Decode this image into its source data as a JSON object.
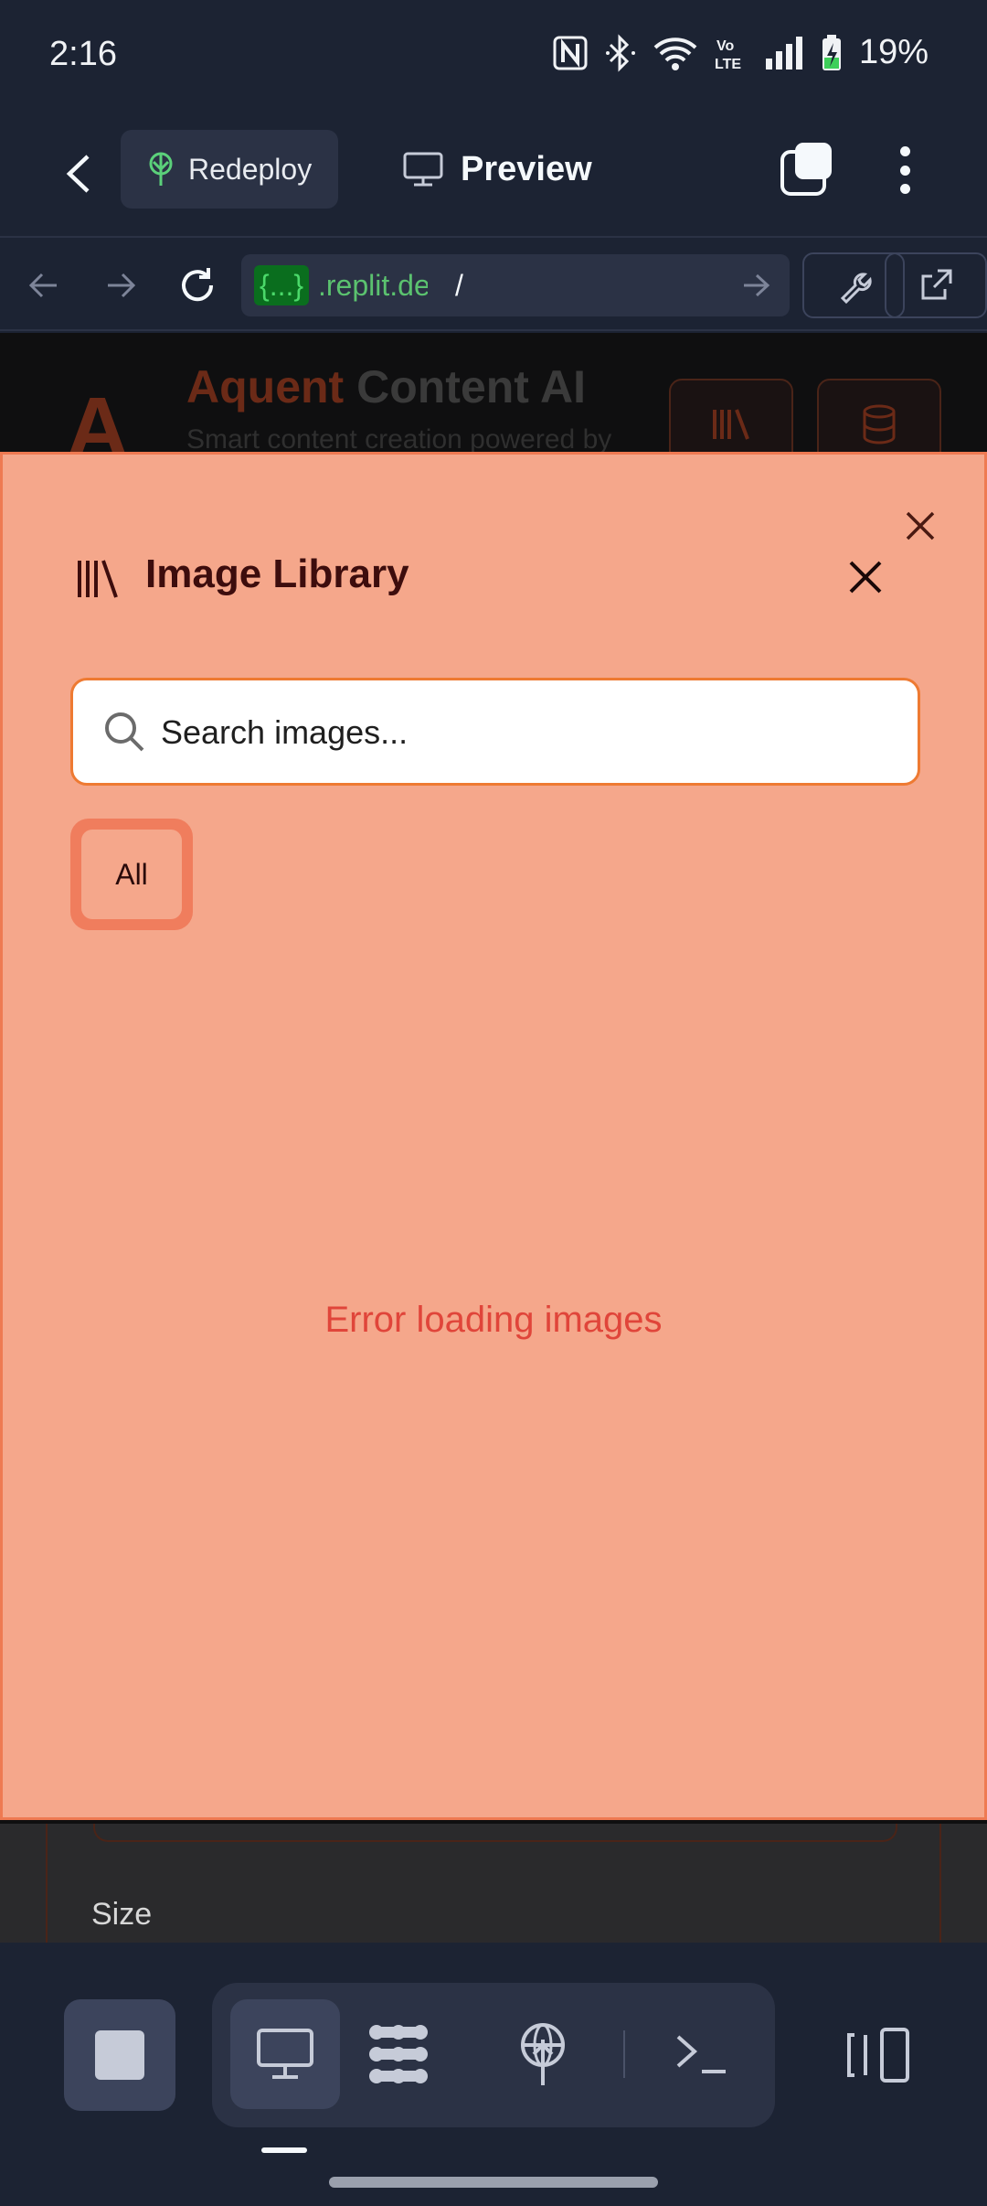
{
  "status_bar": {
    "time": "2:16",
    "battery": "19%",
    "icons": [
      "nfc-icon",
      "bluetooth-icon",
      "wifi-icon",
      "volte-icon",
      "signal-icon",
      "battery-charging-icon"
    ],
    "volte_text": "Vo LTE"
  },
  "app_bar": {
    "redeploy_label": "Redeploy",
    "preview_label": "Preview"
  },
  "url_bar": {
    "badge": "{...}",
    "domain": ".replit.de",
    "path": "/"
  },
  "web_background": {
    "logo_letter": "A",
    "title_brand": "Aquent",
    "title_rest": " Content AI",
    "subtitle": "Smart content creation powered by",
    "size_label": "Size"
  },
  "modal": {
    "title": "Image Library",
    "search_placeholder": "Search images...",
    "filters": [
      "All"
    ],
    "error_message": "Error loading images"
  },
  "colors": {
    "app_bg": "#1c2333",
    "modal_bg": "#f5a78b",
    "accent": "#ee7a32",
    "error": "#e0453a"
  }
}
